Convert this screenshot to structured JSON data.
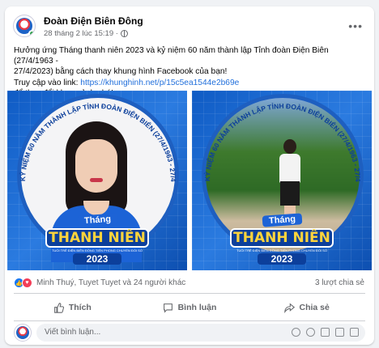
{
  "post": {
    "page_name": "Đoàn Điện Biên Đông",
    "timestamp": "28 tháng 2 lúc 15:19 ·",
    "privacy_icon": "globe-icon",
    "more_icon": "more-horizontal-icon",
    "text_line1": "Hưởng ứng Tháng thanh niên 2023 và kỷ niệm 60 năm thành lập Tỉnh đoàn Điện Biên (27/4/1963 -",
    "text_line2": "27/4/2023) bằng cách thay khung hình Facebook của bạn!",
    "text_line3_prefix": "Truy cập vào link: ",
    "link": "https://khunghinh.net/p/15c5ea1544e2b69e",
    "text_line4": "để thay đổi khung ảnh nhé!"
  },
  "frame": {
    "arc_text": "KỶ NIỆM 60 NĂM THÀNH LẬP TỈNH ĐOÀN ĐIỆN BIÊN (27/4/1963 - 27/4/2023)",
    "thang": "Tháng",
    "thanh_nien": "THANH NIÊN",
    "slogan": "TUỔI TRẺ ĐIỆN BIÊN ĐỒNG TIẾN PHONG CHUYỂN ĐỔI SỐ",
    "year": "2023"
  },
  "stats": {
    "reactions": "Minh Thuý, Tuyet Tuyet và 24 người khác",
    "shares": "3 lượt chia sẻ"
  },
  "actions": {
    "like": "Thích",
    "comment": "Bình luận",
    "share": "Chia sẻ"
  },
  "comment_box": {
    "placeholder": "Viết bình luận..."
  },
  "colors": {
    "link": "#216fdb",
    "like_blue": "#1877f2",
    "love_red": "#f33e58",
    "frame_blue": "#1a64c8"
  }
}
